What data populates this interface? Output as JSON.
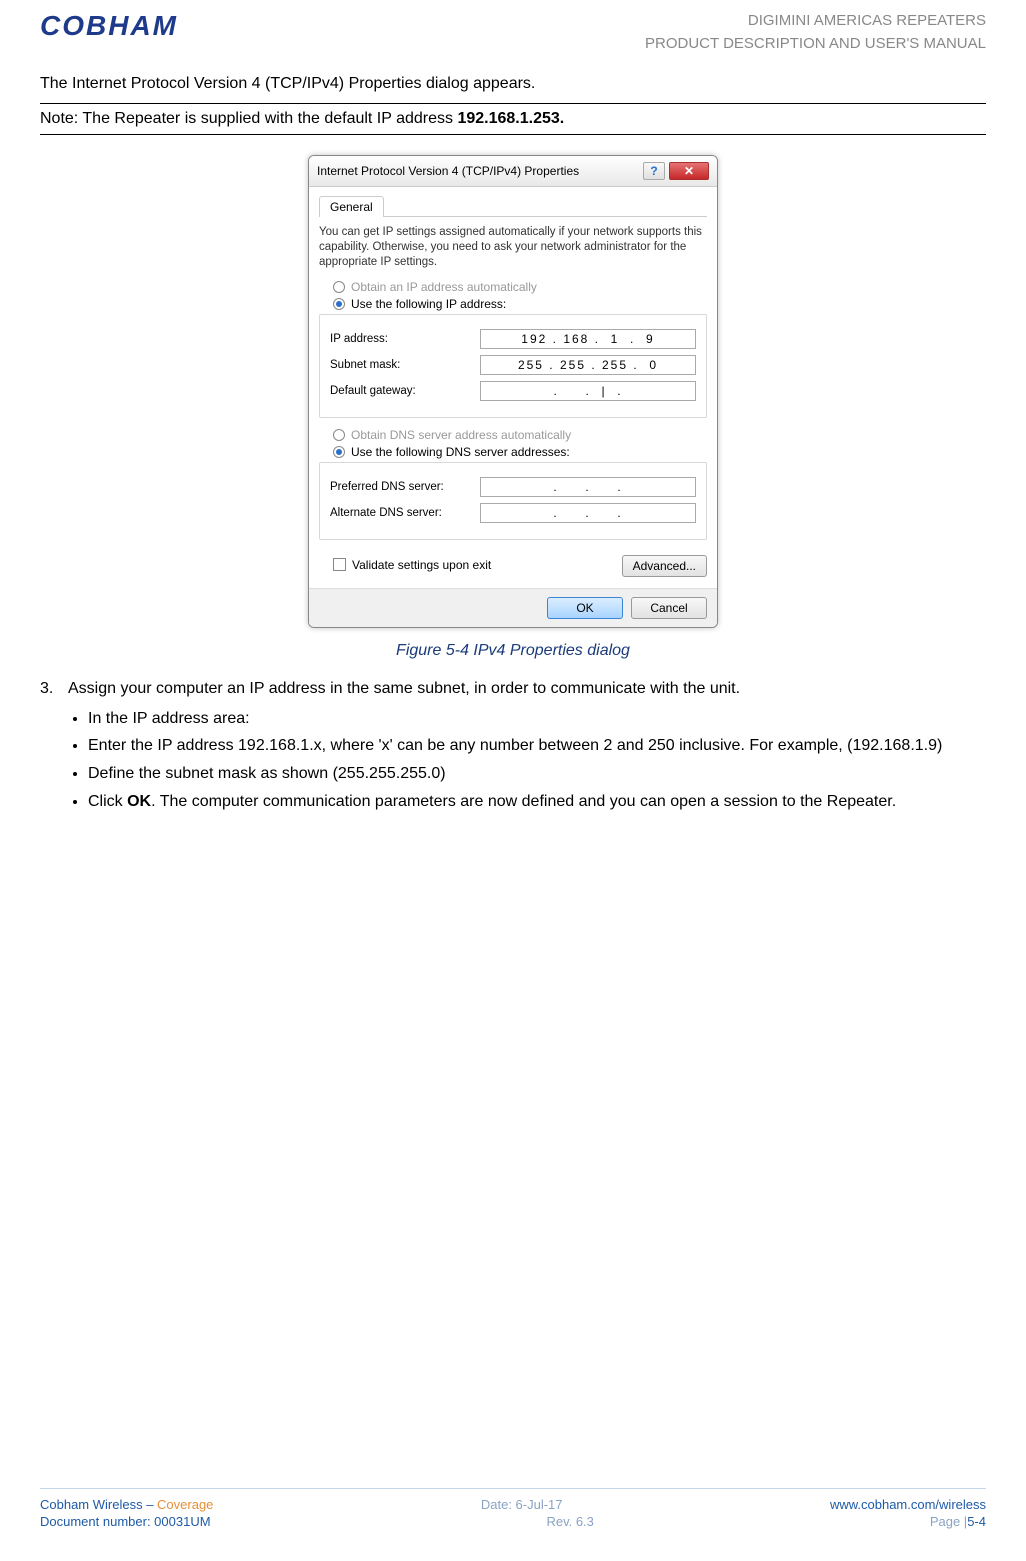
{
  "header": {
    "logo": "COBHAM",
    "line1": "DIGIMINI AMERICAS REPEATERS",
    "line2": "PRODUCT DESCRIPTION AND USER'S MANUAL"
  },
  "intro": "The Internet Protocol Version 4 (TCP/IPv4) Properties dialog appears.",
  "note": {
    "label": "Note:",
    "text_prefix": "  The Repeater is supplied with the default IP address ",
    "ip": "192.168.1.253."
  },
  "dialog": {
    "title": "Internet Protocol Version 4 (TCP/IPv4) Properties",
    "help_symbol": "?",
    "close_symbol": "✕",
    "tab": "General",
    "description": "You can get IP settings assigned automatically if your network supports this capability. Otherwise, you need to ask your network administrator for the appropriate IP settings.",
    "radio_auto_ip": "Obtain an IP address automatically",
    "radio_use_ip": "Use the following IP address:",
    "ip_label": "IP address:",
    "ip_value": "192 . 168 .  1  .  9",
    "subnet_label": "Subnet mask:",
    "subnet_value": "255 . 255 . 255 .  0",
    "gateway_label": "Default gateway:",
    "gateway_value": ".     .  |  .",
    "radio_auto_dns": "Obtain DNS server address automatically",
    "radio_use_dns": "Use the following DNS server addresses:",
    "pref_dns_label": "Preferred DNS server:",
    "pref_dns_value": ".     .     .",
    "alt_dns_label": "Alternate DNS server:",
    "alt_dns_value": ".     .     .",
    "validate": "Validate settings upon exit",
    "advanced": "Advanced...",
    "ok": "OK",
    "cancel": "Cancel"
  },
  "caption": "Figure 5-4 IPv4 Properties dialog",
  "step": {
    "num": "3.",
    "text": "Assign your computer an IP address in the same subnet, in order to communicate with the unit."
  },
  "bullets": {
    "b1": "In the IP address area:",
    "b2": "Enter the IP address 192.168.1.x, where 'x' can be any number between 2 and 250 inclusive. For example,  (192.168.1.9)",
    "b3": "Define the subnet mask as shown (255.255.255.0)",
    "b4_prefix": "Click ",
    "b4_bold": "OK",
    "b4_suffix": ". The computer communication parameters are now defined and you can open a session to the Repeater."
  },
  "footer": {
    "left1a": "Cobham Wireless – ",
    "left1b": "Coverage",
    "mid1": "Date: 6-Jul-17",
    "right1": "www.cobham.com/wireless",
    "left2": "Document number: 00031UM",
    "mid2": "Rev. 6.3",
    "right2a": "Page |",
    "right2b": "5-4"
  }
}
